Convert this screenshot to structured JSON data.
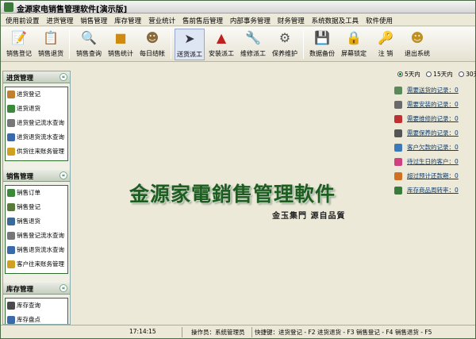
{
  "window": {
    "title": "金源家电销售管理软件[演示版]"
  },
  "menu": [
    "使用前设置",
    "进货管理",
    "销售管理",
    "库存管理",
    "营业统计",
    "售前售后管理",
    "内部事务管理",
    "财务管理",
    "系统数据及工具",
    "软件使用"
  ],
  "toolbar": [
    {
      "label": "销售登记",
      "icon": "register-icon"
    },
    {
      "label": "销售退货",
      "icon": "return-icon"
    },
    {
      "label": "销售查询",
      "icon": "search-icon"
    },
    {
      "label": "销售统计",
      "icon": "chart-icon"
    },
    {
      "label": "每日结帐",
      "icon": "person-icon"
    },
    {
      "label": "送货派工",
      "icon": "send-icon"
    },
    {
      "label": "安装派工",
      "icon": "house-icon"
    },
    {
      "label": "维修派工",
      "icon": "wrench-icon"
    },
    {
      "label": "保养维护",
      "icon": "maintenance-icon"
    },
    {
      "label": "数据备份",
      "icon": "backup-icon"
    },
    {
      "label": "屏幕锁定",
      "icon": "lock-icon"
    },
    {
      "label": "注 销",
      "icon": "key-icon"
    },
    {
      "label": "退出系统",
      "icon": "exit-icon"
    }
  ],
  "sidebar": {
    "groups": [
      {
        "title": "进货管理",
        "items": [
          "进货登记",
          "进货退货",
          "进货登记流水查询",
          "进货退货流水查询",
          "供货往来账务管理"
        ]
      },
      {
        "title": "销售管理",
        "items": [
          "销售订单",
          "销售登记",
          "销售退货",
          "销售登记流水查询",
          "销售退货流水查询",
          "客户往来账务管理"
        ]
      },
      {
        "title": "库存管理",
        "items": [
          "库存查询",
          "库存盘点"
        ]
      }
    ],
    "collapse_glyph": "«"
  },
  "logo": {
    "title": "金源家電銷售管理軟件",
    "slogan": "金玉集門 源自品質"
  },
  "filter": [
    {
      "label": "5天内",
      "checked": true
    },
    {
      "label": "15天内",
      "checked": false
    },
    {
      "label": "30天内",
      "checked": false
    }
  ],
  "reminders": [
    "需要送货的记录：0",
    "需要安装的记录：0",
    "需要维修的记录：0",
    "需要保养的记录：0",
    "客户欠款的记录：0",
    "待过生日的客户：0",
    "超过预计还款期：0",
    "库存商品周转率：0"
  ],
  "status": {
    "time": "17:14:15",
    "operator": "操作员：系统管理员",
    "hotkeys": "快捷键：进货登记 - F2  进货退货 - F3  销售登记 - F4  销售退货 - F5"
  },
  "colors": {
    "accent": "#2f6c2f",
    "logo": "#1d5d20"
  }
}
